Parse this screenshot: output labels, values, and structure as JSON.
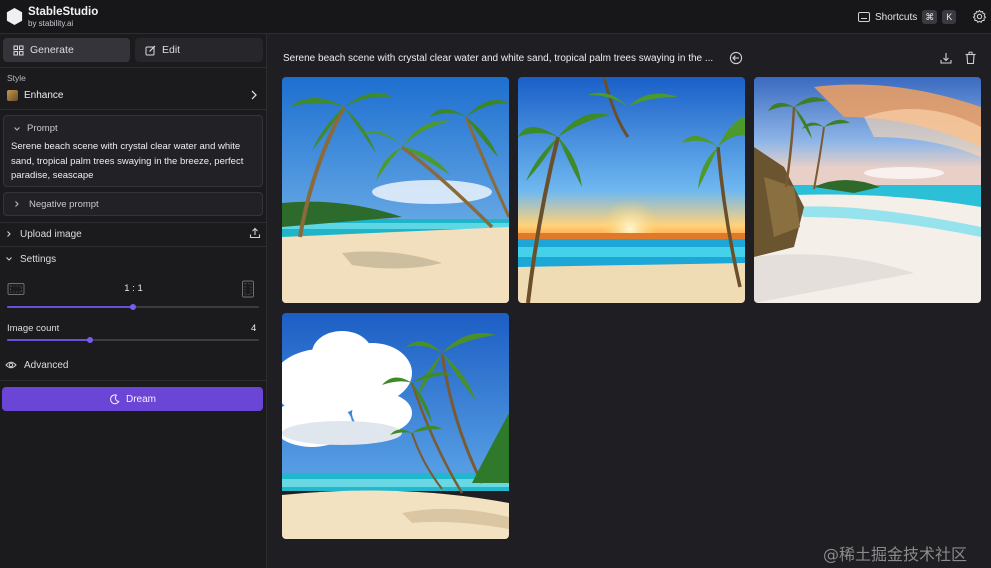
{
  "app": {
    "name": "StableStudio",
    "by": "by stability.ai"
  },
  "topbar": {
    "shortcuts_label": "Shortcuts",
    "shortcut_keys": [
      "⌘",
      "K"
    ],
    "settings_icon": "gear-icon"
  },
  "sidebar": {
    "tabs": [
      {
        "label": "Generate",
        "icon": "grid-icon",
        "active": true
      },
      {
        "label": "Edit",
        "icon": "edit-icon",
        "active": false
      }
    ],
    "style": {
      "label": "Style",
      "value": "Enhance"
    },
    "prompt": {
      "label": "Prompt",
      "text": "Serene beach scene with crystal clear water and white sand, tropical palm trees swaying in the breeze, perfect paradise, seascape"
    },
    "negative_prompt": {
      "label": "Negative prompt"
    },
    "upload_image": {
      "label": "Upload image"
    },
    "settings": {
      "label": "Settings",
      "aspect_ratio": "1 : 1",
      "aspect_ratio_fraction": 0.5,
      "image_count_label": "Image count",
      "image_count": "4",
      "image_count_fraction": 0.33
    },
    "advanced": {
      "label": "Advanced"
    },
    "dream_button": "Dream"
  },
  "main": {
    "title": "Serene beach scene with crystal clear water and white sand, tropical palm trees swaying in the ...",
    "images": [
      {
        "name": "beach-image-1"
      },
      {
        "name": "beach-image-2"
      },
      {
        "name": "beach-image-3"
      },
      {
        "name": "beach-image-4"
      }
    ]
  },
  "watermark": "@稀土掘金技术社区",
  "colors": {
    "accent": "#6b45d6",
    "background": "#1f1f23",
    "sidebar": "#1b1b1e"
  }
}
